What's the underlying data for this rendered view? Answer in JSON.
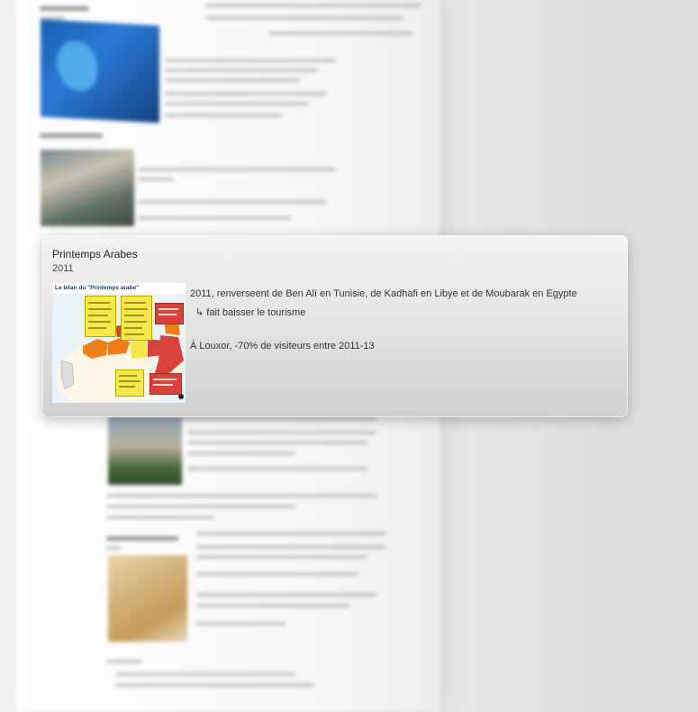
{
  "popup": {
    "title": "Printemps Arabes",
    "year": "2011",
    "image_title": "Le bilan du \"Printemps arabe\"",
    "lines": [
      "2011, renverseent de Ben Alí en Tunisie, de Kadhafi en Libye et de Moubarak en Egypte",
      "↳ fait baisser le tourisme",
      "À Louxor, -70% de visiteurs entre 2011-13"
    ]
  },
  "colors": {
    "accent_yellow": "#f6e84a",
    "accent_red": "#d9423a",
    "accent_orange": "#ef7d1a"
  }
}
